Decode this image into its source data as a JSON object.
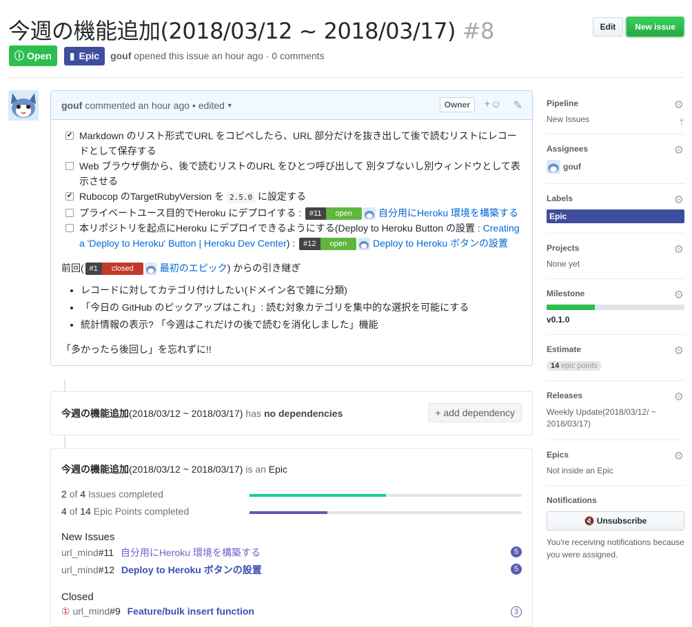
{
  "issue": {
    "title": "今週の機能追加(2018/03/12 ~ 2018/03/17)",
    "number": "#8",
    "state": "Open",
    "epic_badge": "Epic",
    "author": "gouf",
    "meta_text": "opened this issue an hour ago · 0 comments"
  },
  "header_buttons": {
    "edit": "Edit",
    "new_issue": "New issue"
  },
  "comment": {
    "author": "gouf",
    "meta": "commented an hour ago • edited",
    "owner": "Owner",
    "tasks": [
      {
        "checked": true,
        "text": "Markdown のリスト形式でURL をコピペしたら、URL 部分だけを抜き出して後で読むリストにレコードとして保存する"
      },
      {
        "checked": false,
        "text": "Web ブラウザ側から、後で読むリストのURL をひとつ呼び出して 別タブないし別ウィンドウとして表示させる"
      },
      {
        "checked": true,
        "text_a": "Rubocop のTargetRubyVersion を",
        "code": "2.5.0",
        "text_b": "に設定する"
      },
      {
        "checked": false,
        "text": "プライベートユース目的でHeroku にデプロイする :",
        "ref_num": "#11",
        "ref_state": "open",
        "ref_title": "自分用にHeroku 環境を構築する"
      },
      {
        "checked": false,
        "text": "本リポジトリを起点にHeroku にデプロイできるようにする(Deploy to Heroku Button の設置 :",
        "link": "Creating a 'Deploy to Heroku' Button | Heroku Dev Center",
        "after": ") :",
        "ref_num": "#12",
        "ref_state": "open",
        "ref_title": "Deploy to Heroku ボタンの設置"
      }
    ],
    "prev_text_a": "前回(",
    "prev_num": "#1",
    "prev_state": "closed",
    "prev_title": "最初のエピック",
    "prev_text_b": ") からの引き継ぎ",
    "bullets": [
      "レコードに対してカテゴリ付けしたい(ドメイン名で雑に分類)",
      "「今日の GitHub のピックアップはこれ」: 読む対象カテゴリを集中的な選択を可能にする",
      "統計情報の表示? 「今週はこれだけの後で読むを消化しました」機能"
    ],
    "closing": "「多かったら後回し」を忘れずに!!"
  },
  "dependency": {
    "title": "今週の機能追加",
    "title_rest": "(2018/03/12 ~ 2018/03/17)",
    "has": "has",
    "none": "no dependencies",
    "button": "+ add dependency"
  },
  "epic": {
    "title": "今週の機能追加",
    "title_rest": "(2018/03/12 ~ 2018/03/17)",
    "is_an": "is an",
    "kind": "Epic",
    "issues_done": "2",
    "issues_total": "4",
    "issues_label": "Issues completed",
    "issues_progress": 0.5,
    "points_done": "4",
    "points_total": "14",
    "points_label": "Epic Points completed",
    "points_progress": 0.2857,
    "of": "of",
    "new_issues_title": "New Issues",
    "new_issues": [
      {
        "repo": "url_mind",
        "num": "#11",
        "title": "自分用にHeroku 環境を構築する",
        "points": "5"
      },
      {
        "repo": "url_mind",
        "num": "#12",
        "title": "Deploy to Heroku ボタンの設置",
        "points": "5"
      }
    ],
    "closed_title": "Closed",
    "closed_issue": {
      "repo": "url_mind",
      "num": "#9",
      "title": "Feature/bulk insert function",
      "points": "3"
    }
  },
  "sidebar": {
    "pipeline": {
      "heading": "Pipeline",
      "value": "New Issues"
    },
    "assignees": {
      "heading": "Assignees",
      "value": "gouf"
    },
    "labels": {
      "heading": "Labels",
      "value": "Epic"
    },
    "projects": {
      "heading": "Projects",
      "value": "None yet"
    },
    "milestone": {
      "heading": "Milestone",
      "value": "v0.1.0",
      "progress": 0.35
    },
    "estimate": {
      "heading": "Estimate",
      "value": "14",
      "unit": "epic points"
    },
    "releases": {
      "heading": "Releases",
      "value": "Weekly Update(2018/03/12/ ~ 2018/03/17)"
    },
    "epics": {
      "heading": "Epics",
      "value": "Not inside an Epic"
    },
    "notifications": {
      "heading": "Notifications",
      "button": "Unsubscribe",
      "text": "You're receiving notifications because you were assigned."
    }
  },
  "colors": {
    "open_green": "#2cbe4e",
    "epic_indigo": "#3f4d9e",
    "issues_bar": "#20c997",
    "points_bar": "#5a5cb3"
  }
}
